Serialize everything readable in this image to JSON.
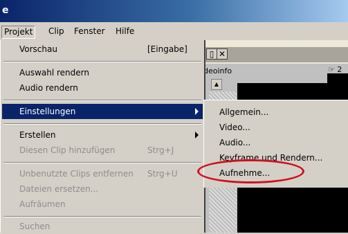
{
  "titlebar": {
    "title": "e"
  },
  "menubar": {
    "items": [
      {
        "label": "Projekt"
      },
      {
        "label": "Clip"
      },
      {
        "label": "Fenster"
      },
      {
        "label": "Hilfe"
      }
    ]
  },
  "background": {
    "panel_label": "deoinfo",
    "panel_label2": "☞ 2"
  },
  "menu": {
    "items": [
      {
        "label": "Vorschau",
        "shortcut": "[Eingabe]"
      },
      {
        "label": "Auswahl rendern"
      },
      {
        "label": "Audio rendern"
      },
      {
        "label": "Einstellungen"
      },
      {
        "label": "Erstellen"
      },
      {
        "label": "Diesen Clip hinzufügen",
        "shortcut": "Strg+J"
      },
      {
        "label": "Unbenutzte Clips entfernen",
        "shortcut": "Strg+U"
      },
      {
        "label": "Dateien ersetzen..."
      },
      {
        "label": "Aufräumen"
      },
      {
        "label": "Suchen"
      }
    ]
  },
  "submenu": {
    "items": [
      {
        "label": "Allgemein..."
      },
      {
        "label": "Video..."
      },
      {
        "label": "Audio..."
      },
      {
        "label": "Keyframe und Rendern..."
      },
      {
        "label": "Aufnehme..."
      }
    ]
  },
  "colors": {
    "highlight": "#0a246a",
    "annotation": "#d01020"
  }
}
